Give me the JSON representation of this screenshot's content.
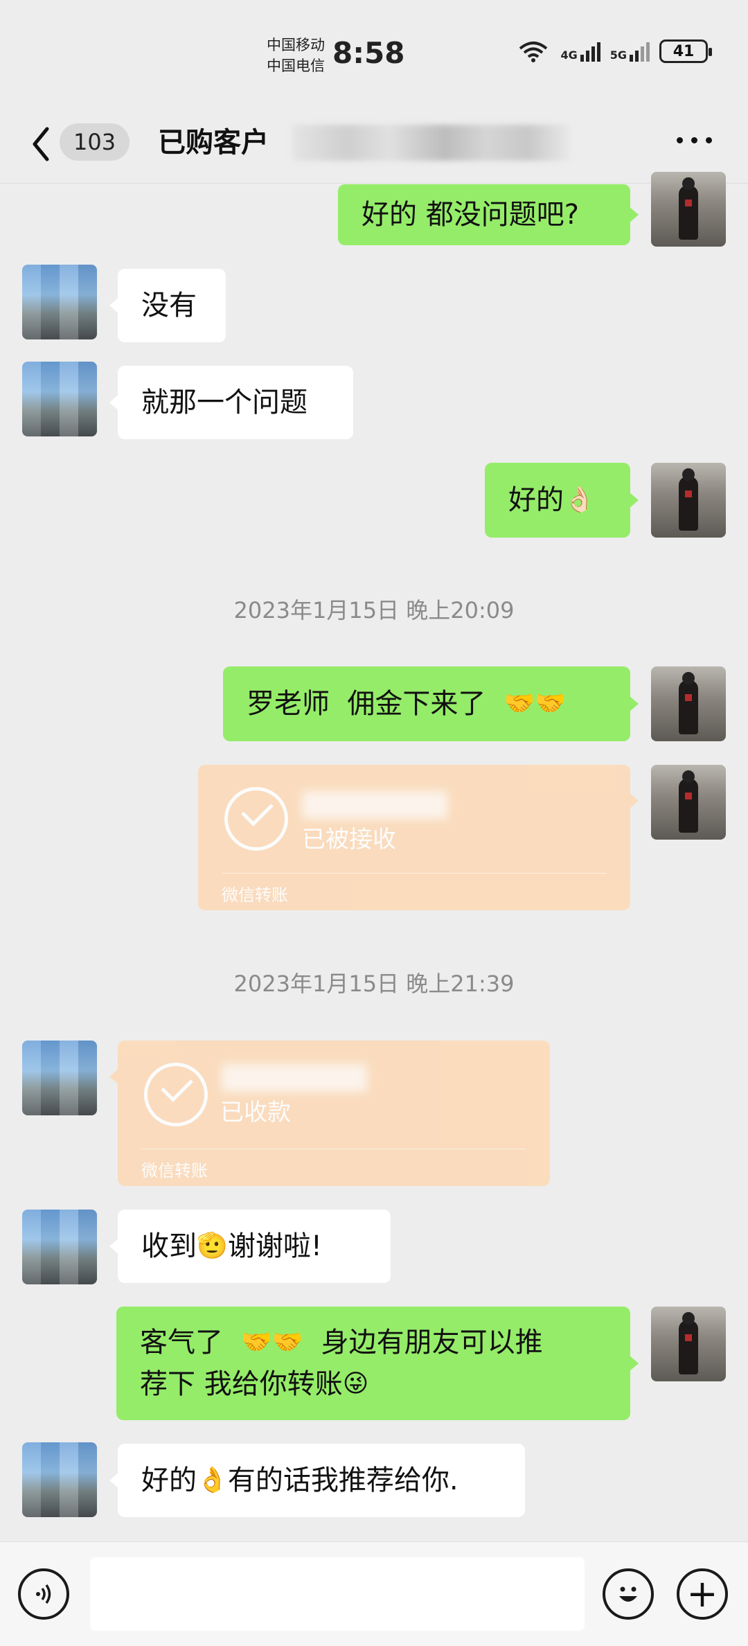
{
  "status_bar": {
    "carrier_1": "中国移动",
    "carrier_2": "中国电信",
    "time": "8:58",
    "wifi_label": "6",
    "net_1": "4G",
    "net_2": "5G",
    "battery": "41"
  },
  "header": {
    "unread_count": "103",
    "title": "已购客户",
    "more_icon": "more-icon"
  },
  "messages": [
    {
      "id": "m1",
      "side": "out",
      "text": "好的 都没问题吧?"
    },
    {
      "id": "m2",
      "side": "in",
      "text": "没有"
    },
    {
      "id": "m3",
      "side": "in",
      "text": "就那一个问题"
    },
    {
      "id": "m4",
      "side": "out",
      "text": "好的",
      "emoji": "👌🏻"
    },
    {
      "id": "t1",
      "type": "timestamp",
      "text": "2023年1月15日 晚上20:09"
    },
    {
      "id": "m5",
      "side": "out",
      "text": "罗老师  佣金下来了",
      "emoji": "🤝🤝"
    },
    {
      "id": "m6",
      "side": "out",
      "type": "transfer",
      "status": "已被接收",
      "kind": "微信转账"
    },
    {
      "id": "t2",
      "type": "timestamp",
      "text": "2023年1月15日 晚上21:39"
    },
    {
      "id": "m7",
      "side": "in",
      "type": "transfer",
      "status": "已收款",
      "kind": "微信转账"
    },
    {
      "id": "m8",
      "side": "in",
      "text_a": "收到",
      "emoji": "🫡",
      "text_b": "谢谢啦!"
    },
    {
      "id": "m9",
      "side": "out",
      "line_1a": "客气了",
      "emoji_1": "🤝🤝",
      "line_1b": "身边有朋友可以推",
      "line_2": "荐下 我给你转账",
      "emoji_2": "😜"
    },
    {
      "id": "m10",
      "side": "in",
      "text_a": "好的",
      "emoji": "👌",
      "text_b": "有的话我推荐给你."
    }
  ],
  "input_bar": {
    "voice_icon": "voice-icon",
    "emoji_icon": "emoji-icon",
    "plus_icon": "plus-icon",
    "plus_glyph": "+"
  },
  "colors": {
    "background": "#ededed",
    "outgoing_bubble": "#95ec69",
    "incoming_bubble": "#ffffff",
    "transfer_card": "#fdd9b5"
  }
}
